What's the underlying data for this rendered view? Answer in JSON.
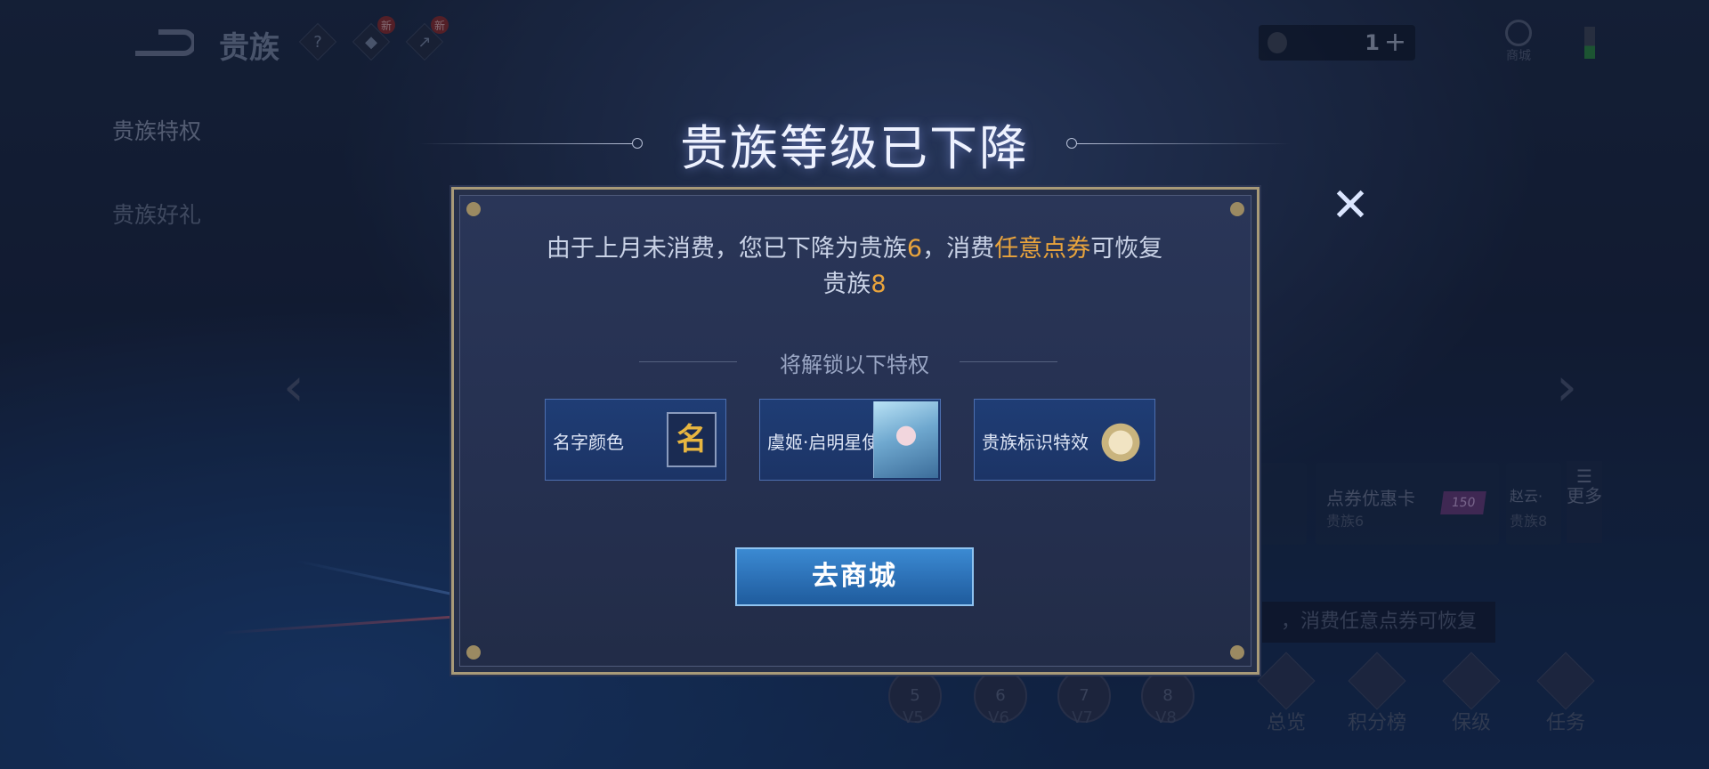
{
  "topbar": {
    "title": "贵族",
    "help_glyph": "?",
    "new_badge": "新",
    "currency_value": "1",
    "plus_glyph": "+",
    "shop_label": "商城"
  },
  "sidebar": {
    "items": [
      {
        "label": "贵族特权"
      },
      {
        "label": "贵族好礼"
      }
    ]
  },
  "dialog": {
    "title": "贵族等级已下降",
    "message_part1": "由于上月未消费，您已下降为贵族",
    "message_level_now": "6",
    "message_part2": "，消费",
    "message_highlight": "任意点券",
    "message_part3": "可恢复",
    "message_part4": "贵族",
    "message_level_restore": "8",
    "unlock_heading": "将解锁以下特权",
    "privileges": [
      {
        "label": "名字颜色",
        "icon_text": "名"
      },
      {
        "label": "虞姬·启明星使"
      },
      {
        "label": "贵族标识特效"
      }
    ],
    "go_button": "去商城",
    "close_glyph": "✕"
  },
  "background": {
    "card_title": "点券优惠卡",
    "card_sub": "贵族6",
    "card_tag": "150",
    "card2_title": "赵云·",
    "card2_sub": "贵族8",
    "more_label": "更多",
    "tooltip": "，消费任意点券可恢复",
    "levels": [
      "V5",
      "V6",
      "V7",
      "V8"
    ],
    "level_nums": [
      "5",
      "6",
      "7",
      "8"
    ],
    "nav": [
      "总览",
      "积分榜",
      "保级",
      "任务"
    ]
  },
  "colors": {
    "highlight": "#e9a43c",
    "button": "#2d72b8",
    "dialog_border": "#a89a78"
  }
}
